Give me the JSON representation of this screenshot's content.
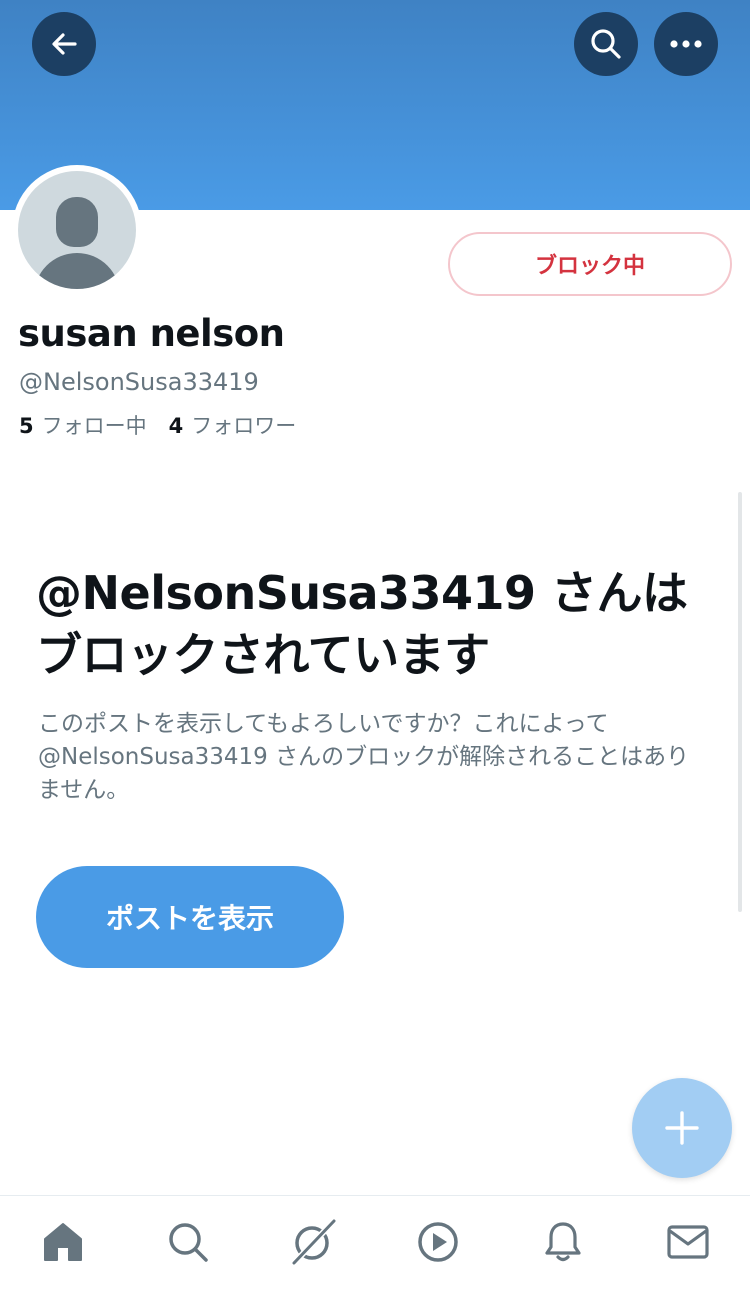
{
  "header": {
    "back_icon": "arrow-left-icon",
    "search_icon": "search-icon",
    "more_icon": "more-dots-icon",
    "banner_color": "#4a9be6"
  },
  "profile": {
    "display_name": "susan nelson",
    "handle": "@NelsonSusa33419",
    "following_count": "5",
    "following_label": "フォロー中",
    "followers_count": "4",
    "followers_label": "フォロワー",
    "block_button_label": "ブロック中",
    "block_color": "#d4333f"
  },
  "blocked_notice": {
    "title": "@NelsonSusa33419 さんはブロックされています",
    "description": "このポストを表示してもよろしいですか？これによって @NelsonSusa33419 さんのブロックが解除されることはありません。",
    "show_button_label": "ポストを表示",
    "accent_color": "#4a9be6"
  },
  "fab": {
    "icon": "plus-icon"
  },
  "tabbar": {
    "items": [
      {
        "name": "home",
        "icon": "home-icon"
      },
      {
        "name": "search",
        "icon": "search-icon"
      },
      {
        "name": "grok",
        "icon": "grok-icon"
      },
      {
        "name": "video",
        "icon": "play-circle-icon"
      },
      {
        "name": "notifications",
        "icon": "bell-icon"
      },
      {
        "name": "messages",
        "icon": "envelope-icon"
      }
    ]
  }
}
